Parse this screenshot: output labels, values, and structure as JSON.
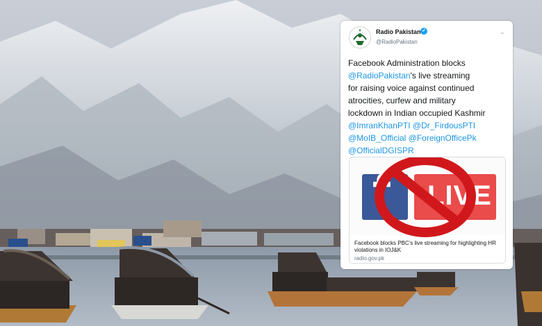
{
  "tweet": {
    "account_name": "Radio Pakistan",
    "handle": "@RadioPakistan",
    "body": [
      [
        {
          "text": "Facebook Administration blocks",
          "m": false
        }
      ],
      [
        {
          "text": "@RadioPakistan",
          "m": true
        },
        {
          "text": "'s live streaming",
          "m": false
        }
      ],
      [
        {
          "text": "for raising voice against continued",
          "m": false
        }
      ],
      [
        {
          "text": "atrocities, curfew and military",
          "m": false
        }
      ],
      [
        {
          "text": "lockdown in Indian occupied Kashmir",
          "m": false
        }
      ],
      [
        {
          "text": "@ImranKhanPTI",
          "m": true
        },
        {
          "text": " ",
          "m": false
        },
        {
          "text": "@Dr_FirdousPTI",
          "m": true
        }
      ],
      [
        {
          "text": "@MoIB_Official",
          "m": true
        },
        {
          "text": " ",
          "m": false
        },
        {
          "text": "@ForeignOfficePk",
          "m": true
        }
      ],
      [
        {
          "text": "@OfficialDGISPR",
          "m": true
        }
      ]
    ],
    "card": {
      "image": {
        "logo_letter": "f",
        "live_label": "LIVE"
      },
      "title": "Facebook blocks PBC's live streaming for highlighting HR violations in IOJ&K",
      "domain": "radio.gov.pk"
    }
  },
  "colors": {
    "mention": "#1b95e0",
    "facebook_blue": "#3b5998",
    "live_red": "#ea4b4b",
    "ban_red": "#d0181c",
    "verified": "#1da1f2"
  },
  "icons": {
    "verified": "verified-badge-icon",
    "menu": "chevron-down-icon",
    "avatar": "radio-pakistan-logo",
    "ban": "prohibition-icon"
  }
}
